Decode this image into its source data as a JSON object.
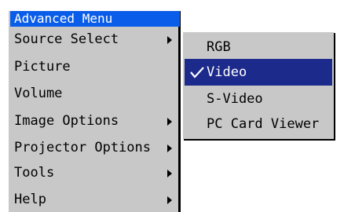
{
  "main_menu": {
    "title": "Advanced Menu",
    "items": [
      {
        "label": "Source Select",
        "has_submenu": true
      },
      {
        "label": "Picture",
        "has_submenu": false
      },
      {
        "label": "Volume",
        "has_submenu": false
      },
      {
        "label": "Image Options",
        "has_submenu": true
      },
      {
        "label": "Projector Options",
        "has_submenu": true
      },
      {
        "label": "Tools",
        "has_submenu": true
      },
      {
        "label": "Help",
        "has_submenu": true
      }
    ]
  },
  "source_submenu": {
    "items": [
      {
        "label": "RGB",
        "selected": false
      },
      {
        "label": "Video",
        "selected": true
      },
      {
        "label": "S-Video",
        "selected": false
      },
      {
        "label": "PC Card Viewer",
        "selected": false
      }
    ]
  },
  "colors": {
    "title_bar": "#0a5de8",
    "selection": "#1c2a8c",
    "menu_background": "#c8c8c8"
  },
  "icons": {
    "submenu_arrow": "arrow-right-icon",
    "selected_mark": "check-icon"
  }
}
